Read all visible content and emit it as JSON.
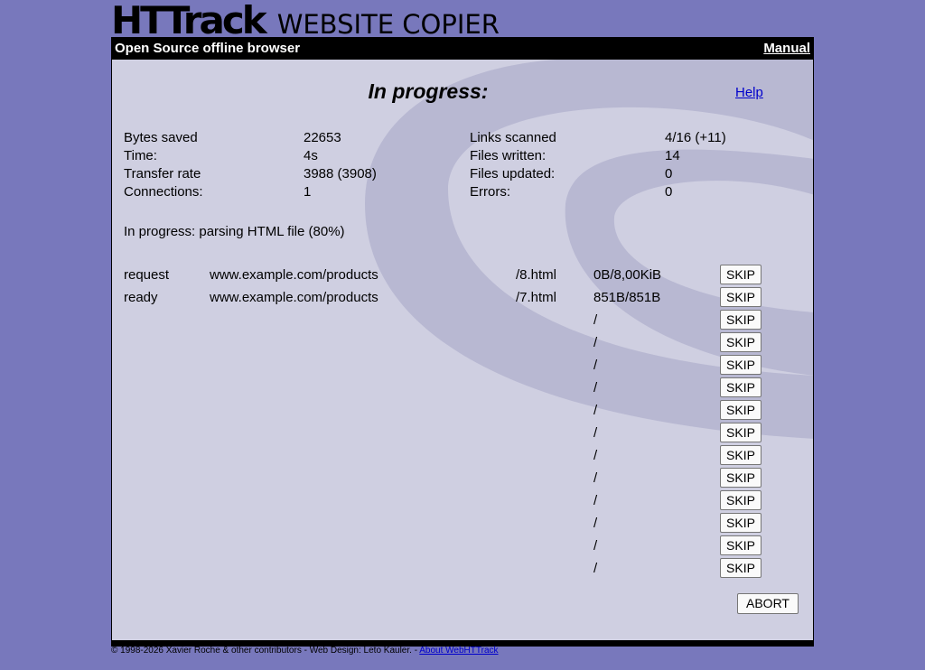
{
  "header": {
    "logo_main": "HTTrack",
    "logo_sub": "WEBSITE COPIER",
    "tagline": "Open Source offline browser",
    "manual_link": "Manual"
  },
  "main": {
    "title": "In progress:",
    "help_link": "Help",
    "stats_left": [
      {
        "label": "Bytes saved",
        "value": "22653"
      },
      {
        "label": "Time:",
        "value": "4s"
      },
      {
        "label": "Transfer rate",
        "value": "3988 (3908)"
      },
      {
        "label": "Connections:",
        "value": "1"
      }
    ],
    "stats_right": [
      {
        "label": "Links scanned",
        "value": "4/16 (+11)"
      },
      {
        "label": "Files written:",
        "value": "14"
      },
      {
        "label": "Files updated:",
        "value": "0"
      },
      {
        "label": "Errors:",
        "value": "0"
      }
    ],
    "status_text": "In progress: parsing HTML file (80%)",
    "transfers": [
      {
        "state": "request",
        "host": "www.example.com/products",
        "file": "/8.html",
        "size": "0B/8,00KiB",
        "button": "SKIP"
      },
      {
        "state": "ready",
        "host": "www.example.com/products",
        "file": "/7.html",
        "size": "851B/851B",
        "button": "SKIP"
      },
      {
        "state": "",
        "host": "",
        "file": "",
        "size": "/",
        "button": "SKIP"
      },
      {
        "state": "",
        "host": "",
        "file": "",
        "size": "/",
        "button": "SKIP"
      },
      {
        "state": "",
        "host": "",
        "file": "",
        "size": "/",
        "button": "SKIP"
      },
      {
        "state": "",
        "host": "",
        "file": "",
        "size": "/",
        "button": "SKIP"
      },
      {
        "state": "",
        "host": "",
        "file": "",
        "size": "/",
        "button": "SKIP"
      },
      {
        "state": "",
        "host": "",
        "file": "",
        "size": "/",
        "button": "SKIP"
      },
      {
        "state": "",
        "host": "",
        "file": "",
        "size": "/",
        "button": "SKIP"
      },
      {
        "state": "",
        "host": "",
        "file": "",
        "size": "/",
        "button": "SKIP"
      },
      {
        "state": "",
        "host": "",
        "file": "",
        "size": "/",
        "button": "SKIP"
      },
      {
        "state": "",
        "host": "",
        "file": "",
        "size": "/",
        "button": "SKIP"
      },
      {
        "state": "",
        "host": "",
        "file": "",
        "size": "/",
        "button": "SKIP"
      },
      {
        "state": "",
        "host": "",
        "file": "",
        "size": "/",
        "button": "SKIP"
      }
    ],
    "abort_button": "ABORT"
  },
  "footer": {
    "copyright": "© 1998-2026 Xavier Roche & other contributors - Web Design: Leto Kauler. - ",
    "about_link": "About WebHTTrack"
  },
  "colors": {
    "page_background": "#7878bc",
    "panel_background": "#cfcfe1",
    "swirl": "#b8b8d2",
    "bars": "#000000",
    "link": "#0000cc"
  }
}
